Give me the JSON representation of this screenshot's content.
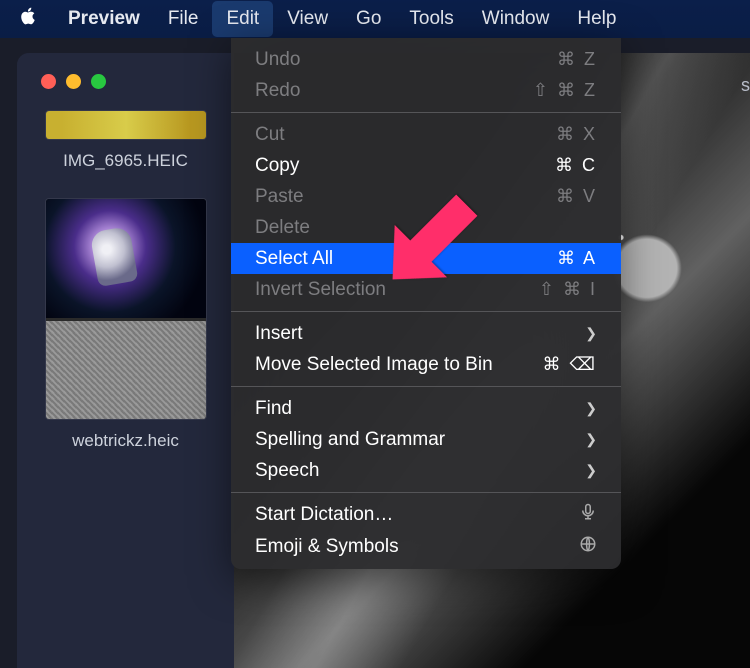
{
  "menubar": {
    "app": "Preview",
    "items": [
      "File",
      "Edit",
      "View",
      "Go",
      "Tools",
      "Window",
      "Help"
    ],
    "active_index": 1,
    "tab_partial": "s"
  },
  "sidebar": {
    "thumbs": [
      {
        "caption": "IMG_6965.HEIC"
      },
      {
        "caption": "webtrickz.heic"
      }
    ]
  },
  "dropdown": {
    "groups": [
      [
        {
          "label": "Undo",
          "disabled": true,
          "shortcut": "⌘ Z"
        },
        {
          "label": "Redo",
          "disabled": true,
          "shortcut": "⇧ ⌘ Z"
        }
      ],
      [
        {
          "label": "Cut",
          "disabled": true,
          "shortcut": "⌘ X"
        },
        {
          "label": "Copy",
          "disabled": false,
          "shortcut": "⌘ C"
        },
        {
          "label": "Paste",
          "disabled": true,
          "shortcut": "⌘ V"
        },
        {
          "label": "Delete",
          "disabled": true
        },
        {
          "label": "Select All",
          "disabled": false,
          "highlight": true,
          "shortcut": "⌘ A"
        },
        {
          "label": "Invert Selection",
          "disabled": true,
          "shortcut": "⇧ ⌘ I"
        }
      ],
      [
        {
          "label": "Insert",
          "disabled": false,
          "submenu": true
        },
        {
          "label": "Move Selected Image to Bin",
          "disabled": false,
          "shortcut": "⌘ ⌫"
        }
      ],
      [
        {
          "label": "Find",
          "disabled": false,
          "submenu": true
        },
        {
          "label": "Spelling and Grammar",
          "disabled": false,
          "submenu": true
        },
        {
          "label": "Speech",
          "disabled": false,
          "submenu": true
        }
      ],
      [
        {
          "label": "Start Dictation…",
          "disabled": false,
          "right_icon": "mic"
        },
        {
          "label": "Emoji & Symbols",
          "disabled": false,
          "right_icon": "globe"
        }
      ]
    ]
  }
}
